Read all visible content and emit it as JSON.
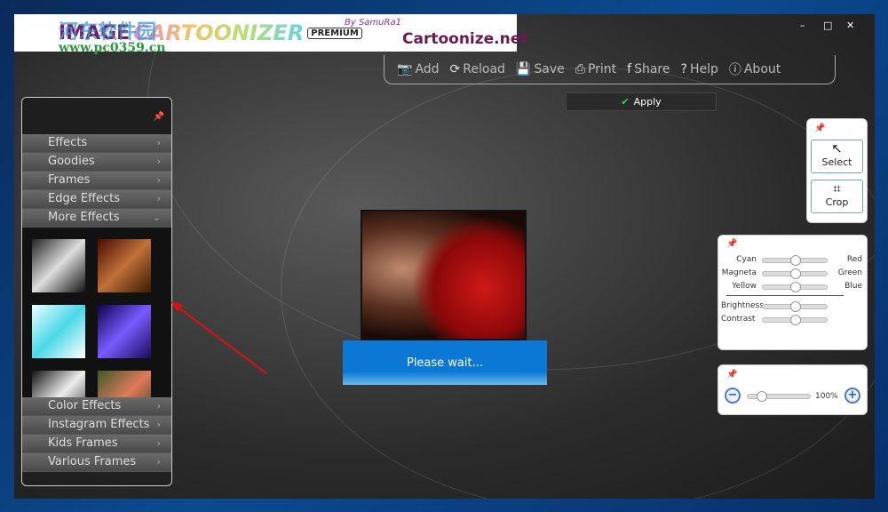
{
  "banner": {
    "title_a": "IMAGE",
    "title_b": "CARTOONIZER",
    "edition": "PREMIUM",
    "byline": "By SamuRa1",
    "site": "Cartoonize.net",
    "watermark_cn": "河东软件园",
    "watermark_url": "www.pc0359.cn"
  },
  "window_controls": {
    "minimize": "–",
    "maximize": "□",
    "close": "✕"
  },
  "toolbar": [
    {
      "icon": "camera-add-icon",
      "glyph": "📷",
      "label": "Add"
    },
    {
      "icon": "reload-icon",
      "glyph": "⟳",
      "label": "Reload"
    },
    {
      "icon": "save-icon",
      "glyph": "💾",
      "label": "Save"
    },
    {
      "icon": "print-icon",
      "glyph": "⎙",
      "label": "Print"
    },
    {
      "icon": "facebook-icon",
      "glyph": "f",
      "label": "Share"
    },
    {
      "icon": "help-icon",
      "glyph": "?",
      "label": "Help"
    },
    {
      "icon": "info-icon",
      "glyph": "ⓘ",
      "label": "About"
    }
  ],
  "apply": {
    "label": "Apply",
    "icon": "✔"
  },
  "left_panel": {
    "pin": "📌",
    "top_items": [
      {
        "label": "Effects",
        "chev": "›"
      },
      {
        "label": "Goodies",
        "chev": "›"
      },
      {
        "label": "Frames",
        "chev": "›"
      },
      {
        "label": "Edge Effects",
        "chev": "›"
      },
      {
        "label": "More Effects",
        "chev": "⌄"
      }
    ],
    "bottom_items": [
      {
        "label": "Color Effects",
        "chev": "›"
      },
      {
        "label": "Instagram Effects",
        "chev": "›"
      },
      {
        "label": "Kids Frames",
        "chev": "›"
      },
      {
        "label": "Various Frames",
        "chev": "›"
      }
    ]
  },
  "status": {
    "wait": "Please wait..."
  },
  "tools": {
    "select": "Select",
    "crop": "Crop"
  },
  "colors": {
    "rows": [
      {
        "left": "Cyan",
        "right": "Red",
        "value": 0.5
      },
      {
        "left": "Magneta",
        "right": "Green",
        "value": 0.5
      },
      {
        "left": "Yellow",
        "right": "Blue",
        "value": 0.5
      }
    ],
    "brightness": {
      "label": "Brightness",
      "value": 0.5
    },
    "contrast": {
      "label": "Contrast",
      "value": 0.5
    }
  },
  "zoom": {
    "value": "100%",
    "minus": "−",
    "plus": "+"
  }
}
